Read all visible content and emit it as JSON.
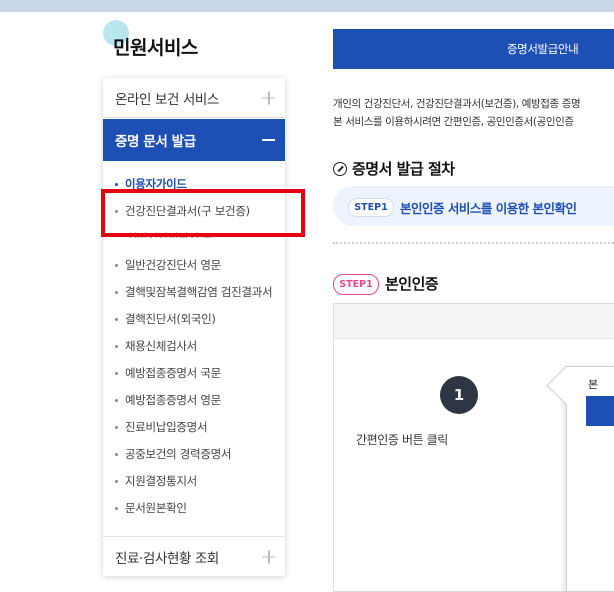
{
  "sidebar": {
    "title": "민원서비스",
    "online_service": "온라인 보건 서비스",
    "cert_issue": "증명 문서 발급",
    "sub_items": [
      {
        "label": "이용자가이드",
        "active": true
      },
      {
        "label": "건강진단결과서(구 보건증)"
      },
      {
        "label": "일반건강진단서 국문"
      },
      {
        "label": "일반건강진단서 영문"
      },
      {
        "label": "결핵및잠복결핵감염 검진결과서"
      },
      {
        "label": "결핵진단서(외국인)"
      },
      {
        "label": "채용신체검사서"
      },
      {
        "label": "예방접종증명서 국문"
      },
      {
        "label": "예방접종증명서 영문"
      },
      {
        "label": "진료비납입증명서"
      },
      {
        "label": "공중보건의 경력증명서"
      },
      {
        "label": "지원결정통지서"
      },
      {
        "label": "문서원본확인"
      }
    ],
    "inspection": "진료·검사현황 조회"
  },
  "main": {
    "header": "증명서발급안내",
    "intro_line1": "개인의 건강진단서, 건강진단결과서(보건증), 예방접종 증명",
    "intro_line2": "본 서비스를 이용하시려면 간편인증, 공인인증서(공인인증",
    "section_title": "증명서 발급 절차",
    "step_pill": "STEP1",
    "step_banner": "본인인증 서비스를 이용한 본인확인",
    "step1_pill": "STEP1",
    "step1_title": "본인인증",
    "step_number": "1",
    "step_desc": "간편인증 버튼 클릭",
    "popup_text": "본"
  },
  "colors": {
    "primary": "#1e4fb5",
    "highlight": "#e60012",
    "step_pink": "#e24b8c"
  }
}
